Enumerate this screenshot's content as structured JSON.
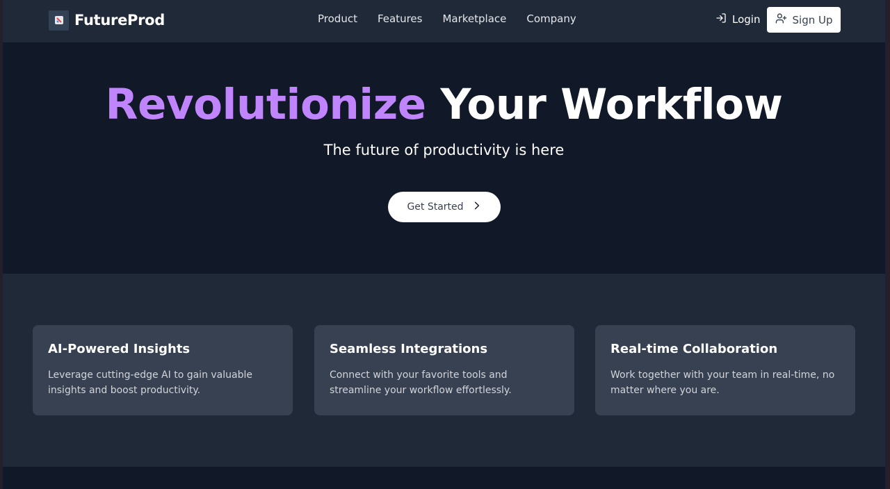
{
  "nav": {
    "brand": "FutureProd",
    "links": [
      "Product",
      "Features",
      "Marketplace",
      "Company"
    ],
    "login_label": "Login",
    "signup_label": "Sign Up"
  },
  "hero": {
    "title_accent": "Revolutionize",
    "title_rest": "Your Workflow",
    "subtitle": "The future of productivity is here",
    "cta_label": "Get Started"
  },
  "features": [
    {
      "title": "AI-Powered Insights",
      "description": "Leverage cutting-edge AI to gain valuable insights and boost productivity."
    },
    {
      "title": "Seamless Integrations",
      "description": "Connect with your favorite tools and streamline your workflow effortlessly."
    },
    {
      "title": "Real-time Collaboration",
      "description": "Work together with your team in real-time, no matter where you are."
    }
  ],
  "colors": {
    "accent": "#c084fc",
    "nav_bg": "#1f2937",
    "page_bg": "#111827",
    "card_bg": "#374151"
  },
  "icons": {
    "logo": "logo-icon",
    "login": "login-icon",
    "signup": "user-plus-icon",
    "cta": "chevron-right-icon"
  }
}
